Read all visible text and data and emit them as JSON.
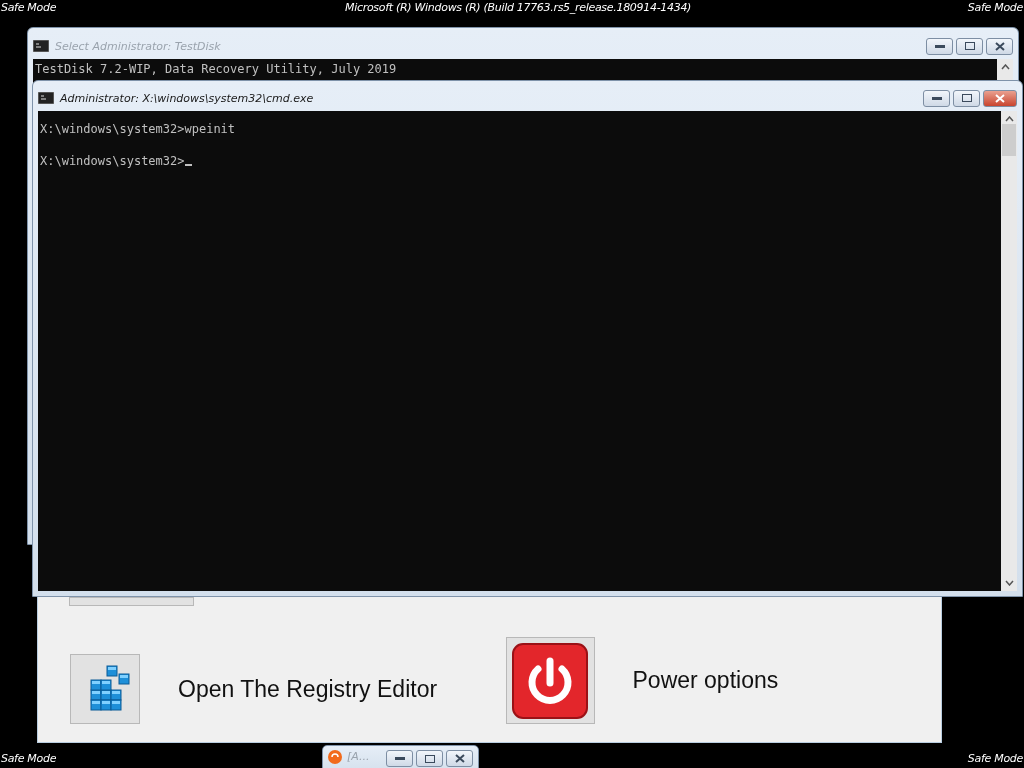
{
  "overlay": {
    "top_left": "Safe Mode",
    "top_center": "Microsoft (R) Windows (R) (Build 17763.rs5_release.180914-1434)",
    "top_right": "Safe Mode",
    "bottom_left": "Safe Mode",
    "bottom_right": "Safe Mode"
  },
  "back_window": {
    "title": "Select Administrator:  TestDisk",
    "lines": [
      "TestDisk 7.2-WIP, Data Recovery Utility, July 2019"
    ]
  },
  "launcher": {
    "items": [
      {
        "kind": "registry",
        "label": "Open The Registry Editor"
      },
      {
        "kind": "power",
        "label": "Power options"
      }
    ]
  },
  "front_window": {
    "title": "Administrator: X:\\windows\\system32\\cmd.exe",
    "lines": [
      "X:\\windows\\system32>wpeinit",
      "X:\\windows\\system32>"
    ]
  },
  "minimized_window": {
    "title": "[A..."
  }
}
